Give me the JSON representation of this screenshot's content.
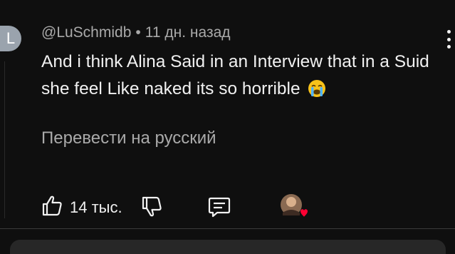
{
  "comment": {
    "avatar_letter": "L",
    "author": "@LuSchmidb",
    "separator": "•",
    "time": "11 дн. назад",
    "text": "And i think  Alina Said in an Interview that in a Suid she feel Like naked its so horrible",
    "emoji_icon": "loudly-crying-face-icon",
    "translate_label": "Перевести на русский",
    "likes": "14 тыс."
  },
  "colors": {
    "background": "#0f0f0f",
    "text_primary": "#f1f1f1",
    "text_secondary": "#aaaaaa",
    "avatar_bg": "#9aa3ad",
    "heart": "#ff0033"
  },
  "icons": {
    "more": "more-vert-icon",
    "like": "thumb-up-icon",
    "dislike": "thumb-down-icon",
    "reply": "reply-comment-icon",
    "creator_heart": "creator-heart-icon"
  }
}
